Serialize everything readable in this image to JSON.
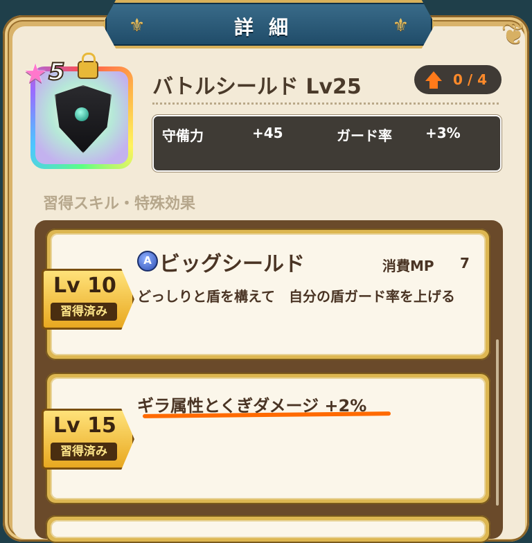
{
  "header": {
    "title": "詳細"
  },
  "item": {
    "rarity_stars": "5",
    "name": "バトルシールド Lv25",
    "upgrade": "0 / 4",
    "stats": [
      {
        "label": "守備力",
        "value": "+45"
      },
      {
        "label": "ガード率",
        "value": "+3%"
      }
    ]
  },
  "section_label": "習得スキル・特殊効果",
  "skills": [
    {
      "level": "Lv 10",
      "status": "習得済み",
      "icon_letter": "A",
      "name": "ビッグシールド",
      "mp_label": "消費MP",
      "mp_value": "7",
      "description": "どっしりと盾を構えて　自分の盾ガード率を上げる"
    },
    {
      "level": "Lv 15",
      "status": "習得済み",
      "effect": "ギラ属性とくぎダメージ +2%"
    }
  ],
  "colors": {
    "highlight": "#ff6a00",
    "banner": "#2a5a7a",
    "gold": "#ddb752"
  }
}
